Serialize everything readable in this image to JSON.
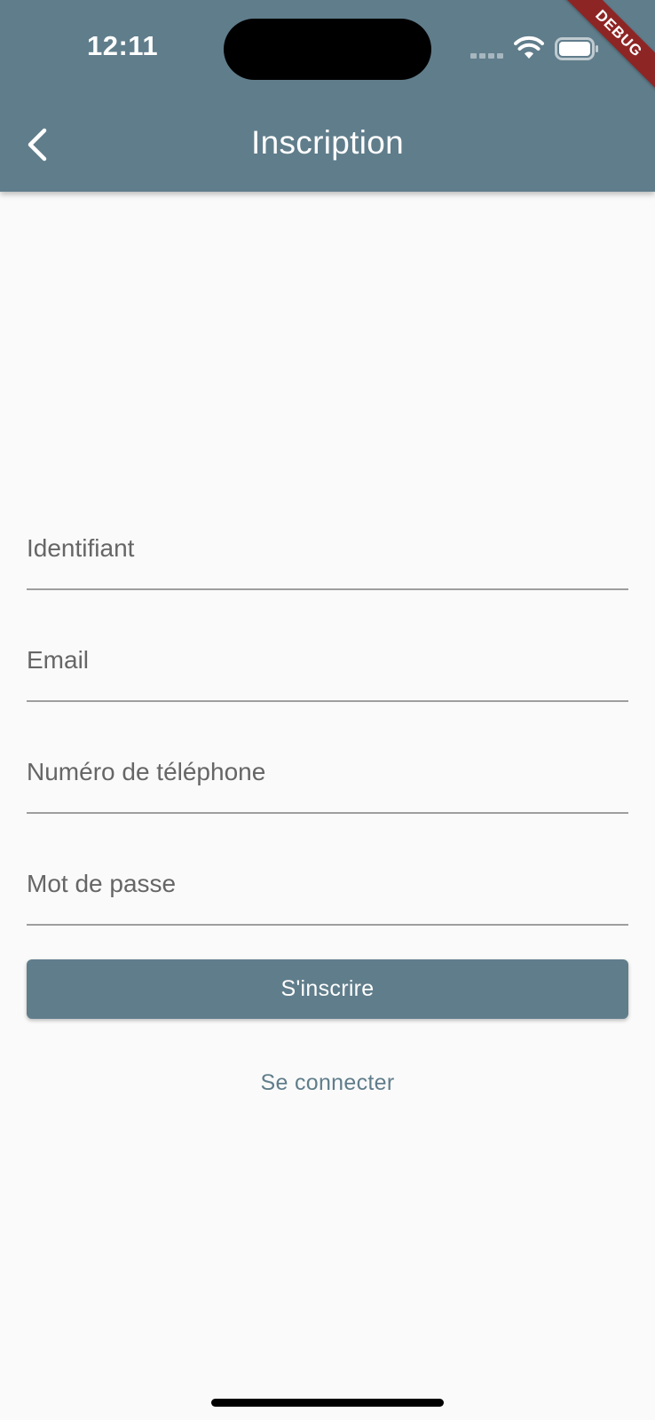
{
  "status_bar": {
    "time": "12:11",
    "debug_banner": "DEBUG"
  },
  "app_bar": {
    "title": "Inscription",
    "back_icon": "chevron-left-icon",
    "background_color": "#607d8b"
  },
  "form": {
    "username_placeholder": "Identifiant",
    "email_placeholder": "Email",
    "phone_placeholder": "Numéro de téléphone",
    "password_placeholder": "Mot de passe",
    "username_value": "",
    "email_value": "",
    "phone_value": "",
    "password_value": ""
  },
  "actions": {
    "register_label": "S'inscrire",
    "login_label": "Se connecter",
    "accent_color": "#607d8b"
  }
}
